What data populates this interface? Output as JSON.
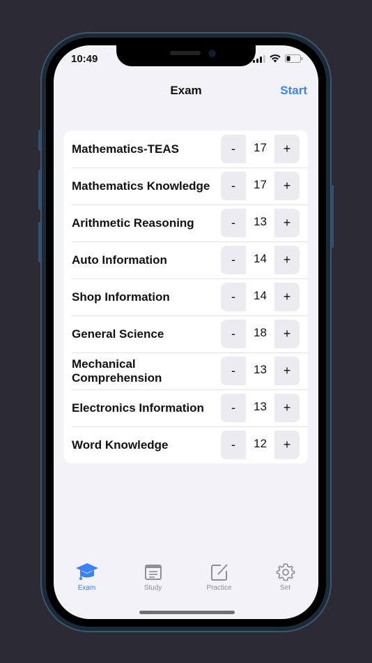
{
  "status": {
    "time": "10:49"
  },
  "nav": {
    "title": "Exam",
    "start_label": "Start"
  },
  "subjects": [
    {
      "label": "Mathematics-TEAS",
      "value": "17"
    },
    {
      "label": "Mathematics Knowledge",
      "value": "17"
    },
    {
      "label": "Arithmetic Reasoning",
      "value": "13"
    },
    {
      "label": "Auto Information",
      "value": "14"
    },
    {
      "label": "Shop Information",
      "value": "14"
    },
    {
      "label": "General Science",
      "value": "18"
    },
    {
      "label": "Mechanical Comprehension",
      "value": "13"
    },
    {
      "label": "Electronics Information",
      "value": "13"
    },
    {
      "label": "Word Knowledge",
      "value": "12"
    }
  ],
  "stepper": {
    "minus": "-",
    "plus": "+"
  },
  "tabbar": {
    "items": [
      {
        "label": "Exam",
        "icon": "graduation-cap-icon",
        "active": true
      },
      {
        "label": "Study",
        "icon": "document-icon"
      },
      {
        "label": "Practice",
        "icon": "edit-icon"
      },
      {
        "label": "Set",
        "icon": "gear-icon"
      }
    ]
  },
  "colors": {
    "accent": "#3a82f7",
    "inactive": "#8e8e93",
    "background": "#f2f2f7"
  }
}
